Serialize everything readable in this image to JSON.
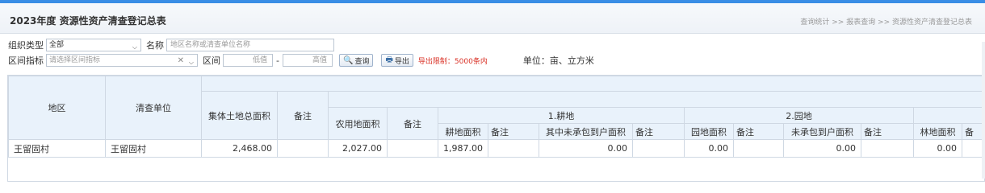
{
  "header": {
    "title": "2023年度 资源性资产清查登记总表",
    "breadcrumb": "查询统计 >> 报表查询 >> 资源性资产清查登记总表"
  },
  "filters": {
    "org_type_label": "组织类型",
    "org_type_value": "全部",
    "name_label": "名称",
    "name_placeholder": "地区名称或清查单位名称",
    "range_indicator_label": "区间指标",
    "range_indicator_placeholder": "请选择区间指标",
    "interval_label": "区间",
    "low_placeholder": "低值",
    "dash": "-",
    "high_placeholder": "高值",
    "query_button": "查询",
    "export_button": "导出",
    "export_limit": "导出限制：5000条内",
    "unit": "单位：亩、立方米"
  },
  "table": {
    "headers": {
      "region": "地区",
      "unit": "清查单位",
      "total_area": "集体土地总面积",
      "remark": "备注",
      "agri_area": "农用地面积",
      "group_farmland": "1.耕地",
      "group_garden": "2.园地",
      "farmland_area": "耕地面积",
      "farmland_uncontracted": "其中未承包到户面积",
      "garden_area": "园地面积",
      "garden_uncontracted": "未承包到户面积",
      "forest_area": "林地面积",
      "cut_off": "备"
    },
    "rows": [
      {
        "region": "王留固村",
        "unit": "王留固村",
        "total_area": "2,468.00",
        "total_remark": "",
        "agri_area": "2,027.00",
        "agri_remark": "",
        "farmland_area": "1,987.00",
        "farmland_remark": "",
        "farmland_uncontracted": "0.00",
        "farmland_uncontracted_remark": "",
        "garden_area": "0.00",
        "garden_remark": "",
        "garden_uncontracted": "0.00",
        "garden_uncontracted_remark": "",
        "forest_area": "0.00"
      }
    ]
  }
}
